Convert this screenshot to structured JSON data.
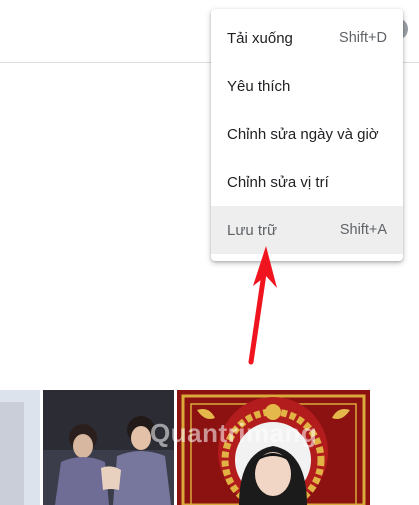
{
  "menu": {
    "items": [
      {
        "label": "Tải xuống",
        "shortcut": "Shift+D"
      },
      {
        "label": "Yêu thích",
        "shortcut": ""
      },
      {
        "label": "Chỉnh sửa ngày và giờ",
        "shortcut": ""
      },
      {
        "label": "Chỉnh sửa vị trí",
        "shortcut": ""
      },
      {
        "label": "Lưu trữ",
        "shortcut": "Shift+A"
      }
    ]
  },
  "watermark": "Quantrimang",
  "colors": {
    "arrow": "#f0141e",
    "menu_highlight": "#eeeeee",
    "thumb_frame": "#8c1212",
    "gold": "#d9a93a"
  },
  "icons": {
    "watermark_logo": "lightbulb-icon"
  }
}
